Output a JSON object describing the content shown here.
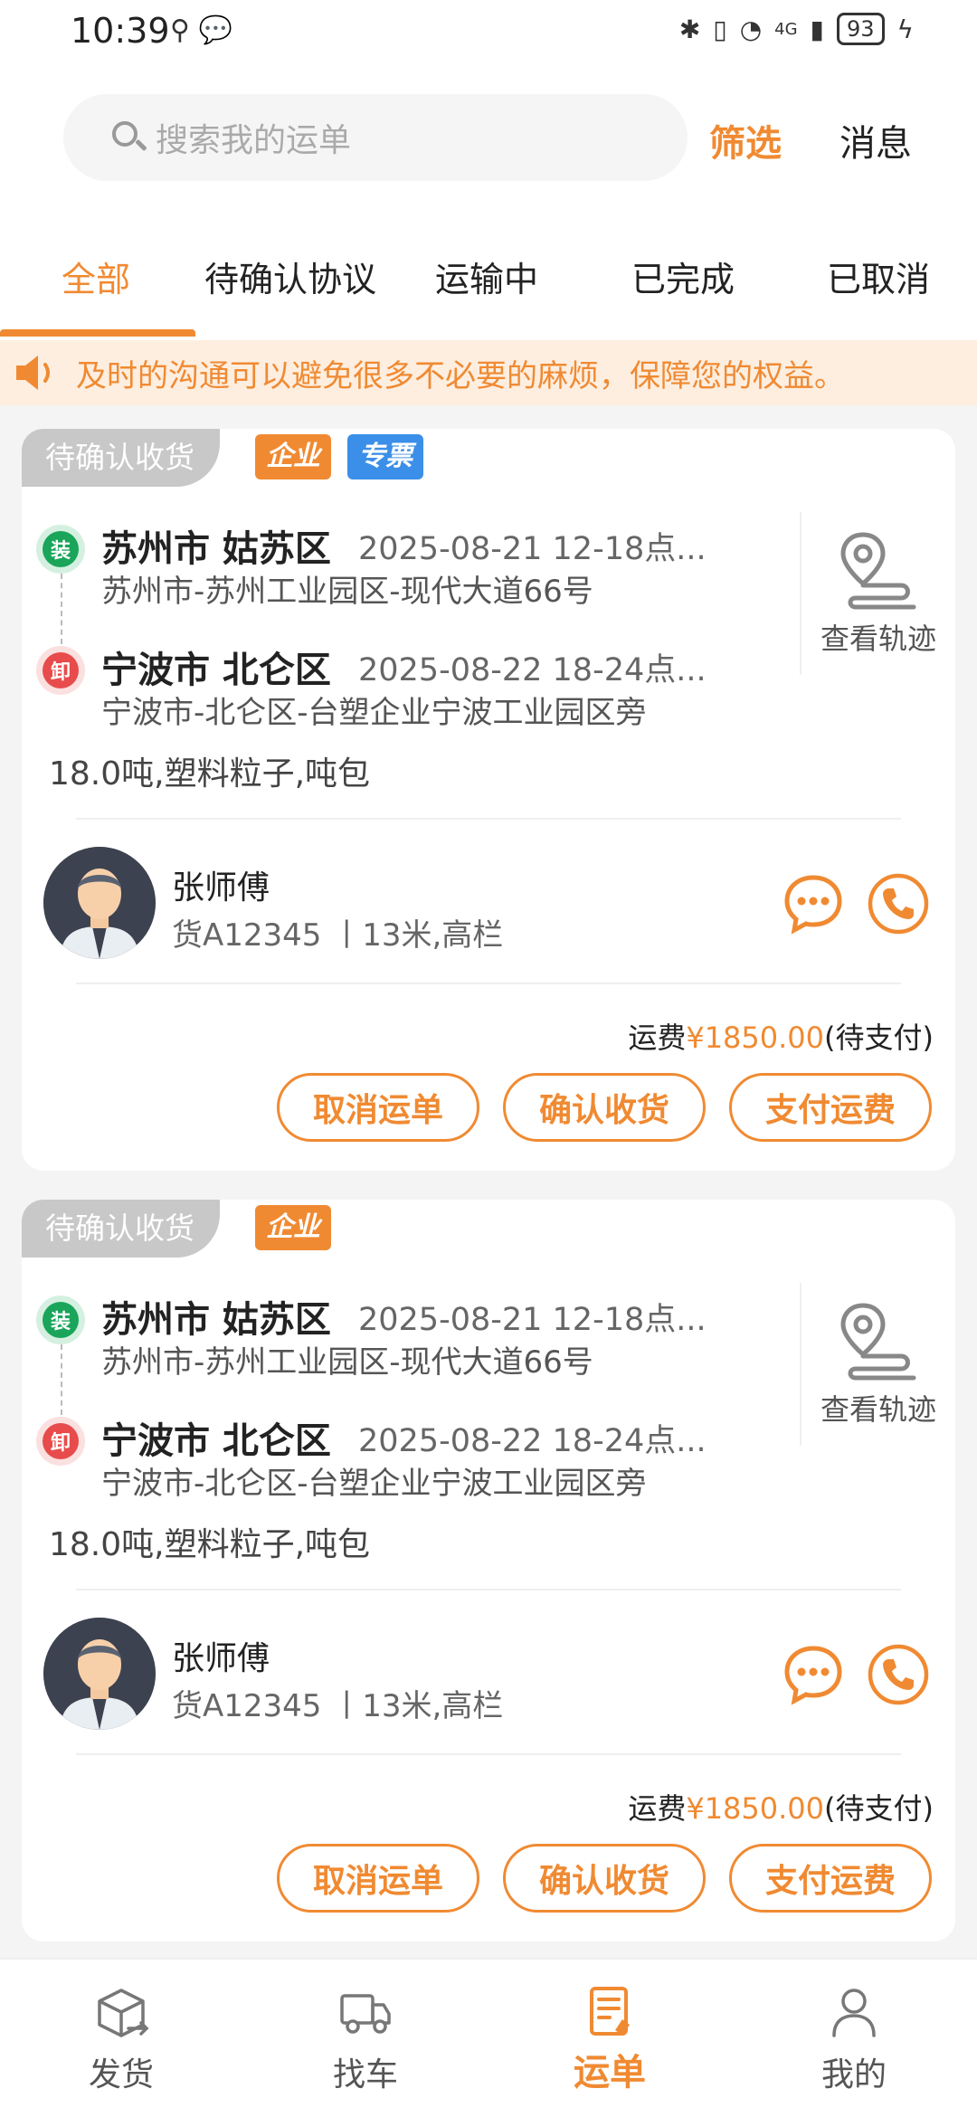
{
  "status_bar": {
    "time": "10:39",
    "battery": "93",
    "network": "4G"
  },
  "header": {
    "search_placeholder": "搜索我的运单",
    "filter": "筛选",
    "messages": "消息"
  },
  "tabs": [
    "全部",
    "待确认协议",
    "运输中",
    "已完成",
    "已取消"
  ],
  "active_tab": "全部",
  "notice": "及时的沟通可以避免很多不必要的麻烦，保障您的权益。",
  "orders": [
    {
      "status": "待确认收货",
      "badges": [
        "企业",
        "专票"
      ],
      "load": {
        "tag": "装",
        "city": "苏州市 姑苏区",
        "time": "2025-08-21 12-18点...",
        "address": "苏州市-苏州工业园区-现代大道66号"
      },
      "unload": {
        "tag": "卸",
        "city": "宁波市 北仑区",
        "time": "2025-08-22 18-24点...",
        "address": "宁波市-北仑区-台塑企业宁波工业园区旁"
      },
      "track_label": "查看轨迹",
      "cargo": "18.0吨,塑料粒子,吨包",
      "driver": {
        "name": "张师傅",
        "truck": "货A12345 丨13米,高栏"
      },
      "fee": {
        "prefix": "运费",
        "amount": "¥1850.00",
        "suffix": "(待支付)"
      },
      "buttons": {
        "cancel": "取消运单",
        "confirm": "确认收货",
        "pay": "支付运费"
      }
    },
    {
      "status": "待确认收货",
      "badges": [
        "企业"
      ],
      "load": {
        "tag": "装",
        "city": "苏州市 姑苏区",
        "time": "2025-08-21 12-18点...",
        "address": "苏州市-苏州工业园区-现代大道66号"
      },
      "unload": {
        "tag": "卸",
        "city": "宁波市 北仑区",
        "time": "2025-08-22 18-24点...",
        "address": "宁波市-北仑区-台塑企业宁波工业园区旁"
      },
      "track_label": "查看轨迹",
      "cargo": "18.0吨,塑料粒子,吨包",
      "driver": {
        "name": "张师傅",
        "truck": "货A12345 丨13米,高栏"
      },
      "fee": {
        "prefix": "运费",
        "amount": "¥1850.00",
        "suffix": "(待支付)"
      },
      "buttons": {
        "cancel": "取消运单",
        "confirm": "确认收货",
        "pay": "支付运费"
      }
    }
  ],
  "bottom_nav": [
    {
      "label": "发货",
      "icon": "box-icon"
    },
    {
      "label": "找车",
      "icon": "truck-icon"
    },
    {
      "label": "运单",
      "icon": "waybill-icon"
    },
    {
      "label": "我的",
      "icon": "profile-icon"
    }
  ],
  "active_nav": "运单",
  "colors": {
    "accent": "#f08a32",
    "load": "#1aa55a",
    "unload": "#e84b4b",
    "invoice": "#3b8fe8"
  }
}
